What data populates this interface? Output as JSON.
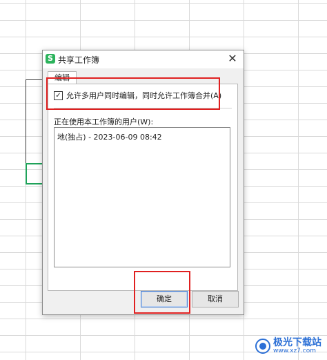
{
  "dialog": {
    "title": "共享工作簿",
    "app_icon_glyph": "S",
    "close_glyph": "✕",
    "tab_label": "编辑",
    "checkbox": {
      "checked": true,
      "check_glyph": "✓",
      "label": "允许多用户同时编辑，同时允许工作簿合并(A)"
    },
    "users_label": "正在使用本工作簿的用户(W):",
    "users": [
      "地(独占) - 2023-06-09 08:42"
    ],
    "ok_label": "确定",
    "cancel_label": "取消"
  },
  "watermark": {
    "title": "极光下载站",
    "url": "www.xz7.com"
  },
  "colors": {
    "highlight": "#e02020",
    "active_cell": "#1fa35a",
    "app_icon": "#2cb35c",
    "watermark": "#2b6fd6"
  }
}
